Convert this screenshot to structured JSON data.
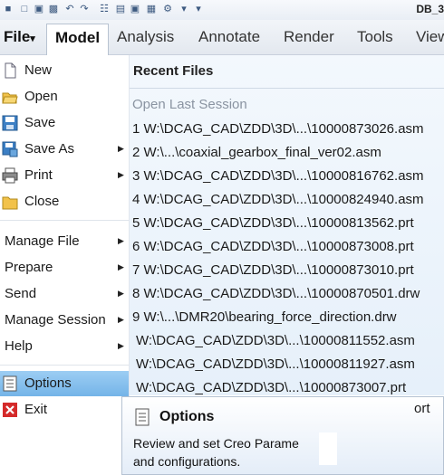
{
  "window": {
    "title": "DB_3"
  },
  "tabs": [
    {
      "label": "File",
      "arrow": "▾"
    },
    {
      "label": "Model"
    },
    {
      "label": "Analysis"
    },
    {
      "label": "Annotate"
    },
    {
      "label": "Render"
    },
    {
      "label": "Tools"
    },
    {
      "label": "View"
    }
  ],
  "menu": {
    "new": "New",
    "open": "Open",
    "save": "Save",
    "save_as": "Save As",
    "print": "Print",
    "close": "Close",
    "manage_file": "Manage File",
    "prepare": "Prepare",
    "send": "Send",
    "manage_session": "Manage Session",
    "help": "Help",
    "options": "Options",
    "exit": "Exit",
    "submenu_arrow": "▶"
  },
  "recent": {
    "title": "Recent Files",
    "open_last": "Open Last Session",
    "items": [
      "1 W:\\DCAG_CAD\\ZDD\\3D\\...\\10000873026.asm",
      "2 W:\\...\\coaxial_gearbox_final_ver02.asm",
      "3 W:\\DCAG_CAD\\ZDD\\3D\\...\\10000816762.asm",
      "4 W:\\DCAG_CAD\\ZDD\\3D\\...\\10000824940.asm",
      "5 W:\\DCAG_CAD\\ZDD\\3D\\...\\10000813562.prt",
      "6 W:\\DCAG_CAD\\ZDD\\3D\\...\\10000873008.prt",
      "7 W:\\DCAG_CAD\\ZDD\\3D\\...\\10000873010.prt",
      "8 W:\\DCAG_CAD\\ZDD\\3D\\...\\10000870501.drw",
      "9 W:\\...\\DMR20\\bearing_force_direction.drw",
      "W:\\DCAG_CAD\\ZDD\\3D\\...\\10000811552.asm",
      "W:\\DCAG_CAD\\ZDD\\3D\\...\\10000811927.asm",
      "W:\\DCAG_CAD\\ZDD\\3D\\...\\10000873007.prt"
    ],
    "overlap_text": "ort"
  },
  "tooltip": {
    "title": "Options",
    "description": "Review and set Creo Parame",
    "description_line2": "and configurations."
  },
  "colors": {
    "selected": "#7fbcec",
    "panel": "#eaf2fb",
    "exit_icon": "#d42a2a"
  }
}
